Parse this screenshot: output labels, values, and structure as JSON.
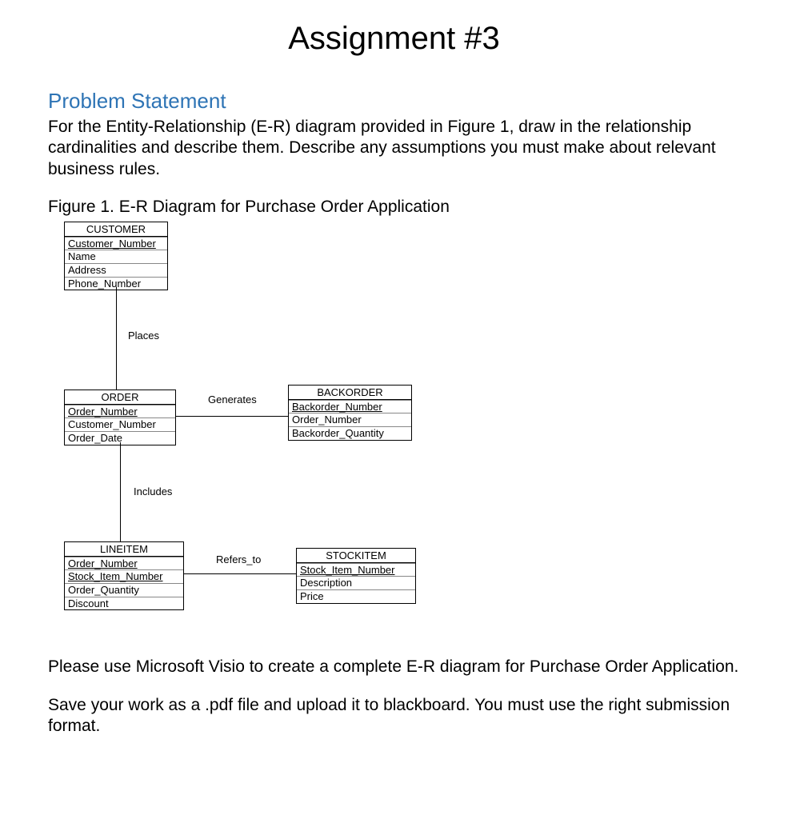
{
  "title": "Assignment #3",
  "section_heading": "Problem Statement",
  "problem_text": "For the Entity-Relationship (E-R) diagram provided in Figure 1, draw in the relationship cardinalities and describe them. Describe any assumptions you must make about relevant business rules.",
  "figure_caption": "Figure 1. E-R Diagram for Purchase Order Application",
  "entities": {
    "customer": {
      "name": "CUSTOMER",
      "attrs": [
        "Customer_Number",
        "Name",
        "Address",
        "Phone_Number"
      ],
      "pk_indices": [
        0
      ]
    },
    "order": {
      "name": "ORDER",
      "attrs": [
        "Order_Number",
        "Customer_Number",
        "Order_Date"
      ],
      "pk_indices": [
        0
      ]
    },
    "backorder": {
      "name": "BACKORDER",
      "attrs": [
        "Backorder_Number",
        "Order_Number",
        "Backorder_Quantity"
      ],
      "pk_indices": [
        0
      ]
    },
    "lineitem": {
      "name": "LINEITEM",
      "attrs": [
        "Order_Number",
        "Stock_Item_Number",
        "Order_Quantity",
        "Discount"
      ],
      "pk_indices": [
        0,
        1
      ]
    },
    "stockitem": {
      "name": "STOCKITEM",
      "attrs": [
        "Stock_Item_Number",
        "Description",
        "Price"
      ],
      "pk_indices": [
        0
      ]
    }
  },
  "relationships": {
    "places": "Places",
    "generates": "Generates",
    "includes": "Includes",
    "refers_to": "Refers_to"
  },
  "instructions_1": "Please use Microsoft Visio to create a complete E-R diagram for Purchase Order Application.",
  "instructions_2": "Save your work as a .pdf file and upload it to blackboard. You must use the right submission format."
}
